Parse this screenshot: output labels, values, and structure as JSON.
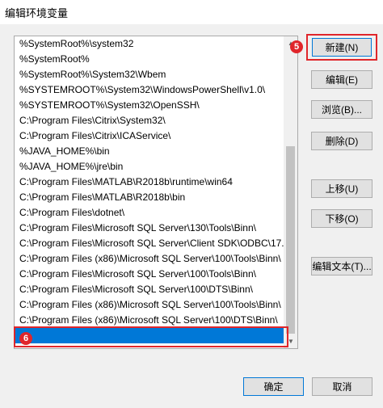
{
  "window": {
    "title": "编辑环境变量"
  },
  "list": {
    "items": [
      "%SystemRoot%\\system32",
      "%SystemRoot%",
      "%SystemRoot%\\System32\\Wbem",
      "%SYSTEMROOT%\\System32\\WindowsPowerShell\\v1.0\\",
      "%SYSTEMROOT%\\System32\\OpenSSH\\",
      "C:\\Program Files\\Citrix\\System32\\",
      "C:\\Program Files\\Citrix\\ICAService\\",
      "%JAVA_HOME%\\bin",
      "%JAVA_HOME%\\jre\\bin",
      "C:\\Program Files\\MATLAB\\R2018b\\runtime\\win64",
      "C:\\Program Files\\MATLAB\\R2018b\\bin",
      "C:\\Program Files\\dotnet\\",
      "C:\\Program Files\\Microsoft SQL Server\\130\\Tools\\Binn\\",
      "C:\\Program Files\\Microsoft SQL Server\\Client SDK\\ODBC\\17...",
      "C:\\Program Files (x86)\\Microsoft SQL Server\\100\\Tools\\Binn\\",
      "C:\\Program Files\\Microsoft SQL Server\\100\\Tools\\Binn\\",
      "C:\\Program Files\\Microsoft SQL Server\\100\\DTS\\Binn\\",
      "C:\\Program Files (x86)\\Microsoft SQL Server\\100\\Tools\\Binn\\",
      "C:\\Program Files (x86)\\Microsoft SQL Server\\100\\DTS\\Binn\\",
      ""
    ]
  },
  "buttons": {
    "new": "新建(N)",
    "edit": "编辑(E)",
    "browse": "浏览(B)...",
    "delete": "删除(D)",
    "move_up": "上移(U)",
    "move_down": "下移(O)",
    "edit_text": "编辑文本(T)..."
  },
  "footer": {
    "ok": "确定",
    "cancel": "取消"
  },
  "annotations": {
    "new_step": "5",
    "entry_step": "6",
    "color": "#e0262b"
  },
  "colors": {
    "selection": "#0078d7"
  }
}
